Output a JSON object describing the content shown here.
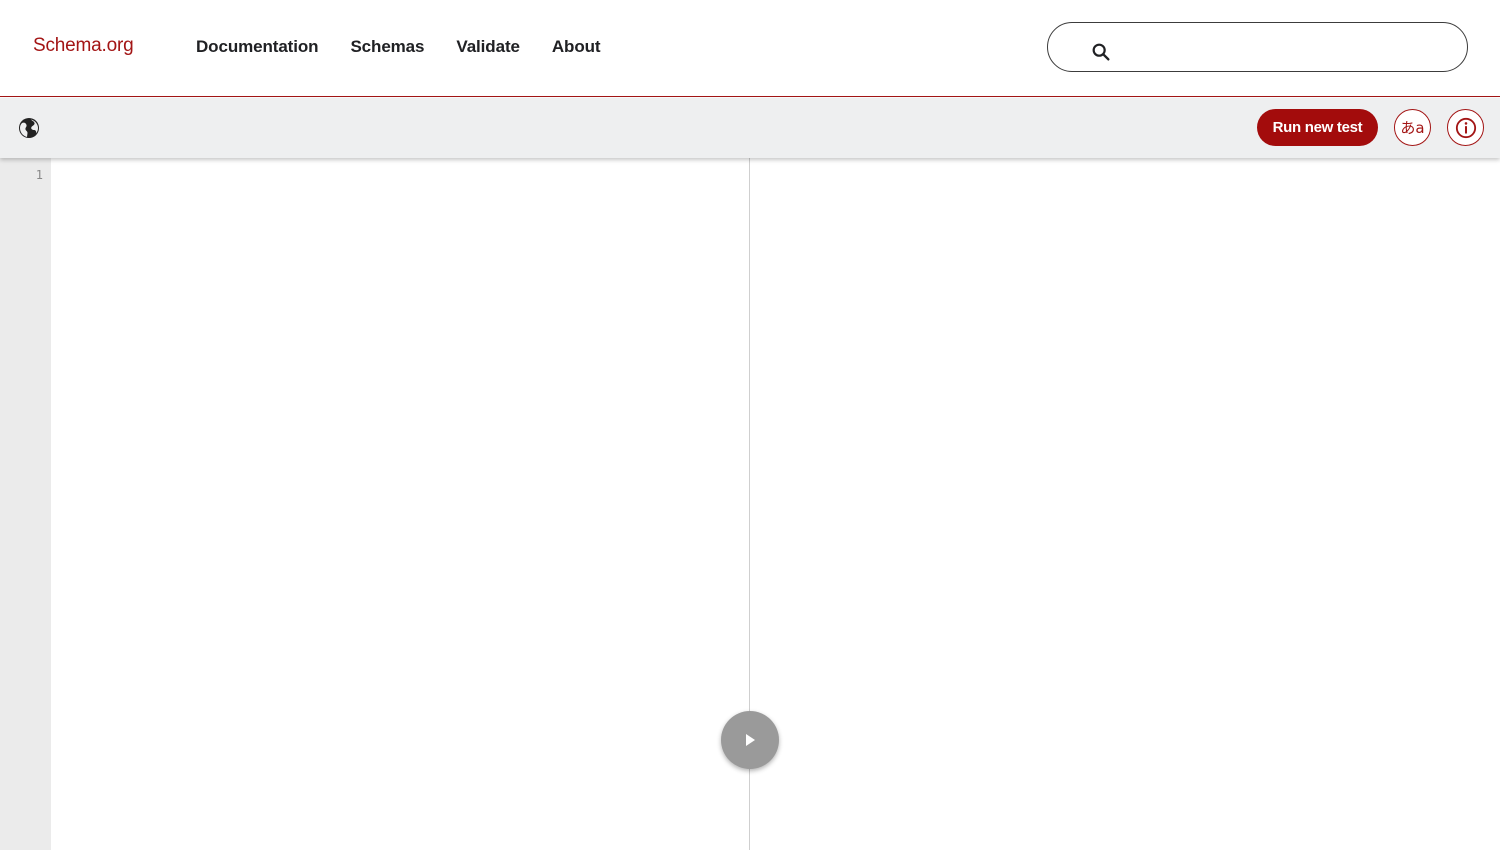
{
  "header": {
    "logo": "Schema.org",
    "nav": [
      {
        "label": "Documentation"
      },
      {
        "label": "Schemas"
      },
      {
        "label": "Validate"
      },
      {
        "label": "About"
      }
    ],
    "search": {
      "placeholder": "",
      "value": ""
    }
  },
  "toolbar": {
    "run_label": "Run new test",
    "language_label": "あa",
    "icons": {
      "globe": "globe-icon",
      "info": "info-icon"
    }
  },
  "editor": {
    "line_numbers": [
      "1"
    ],
    "content": ""
  },
  "colors": {
    "brand": "#a31515",
    "run_button": "#a30c0c",
    "toolbar_bg": "#eeeff0",
    "gutter_bg": "#ebebeb",
    "play_button": "#9a9a9a"
  }
}
